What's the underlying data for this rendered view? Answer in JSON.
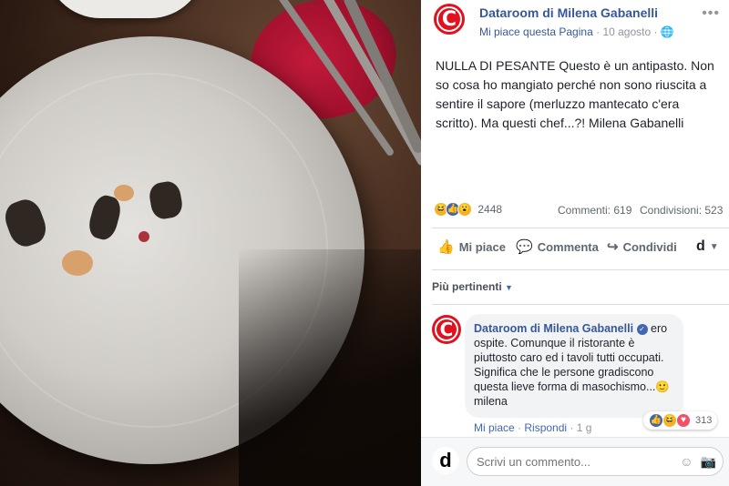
{
  "post": {
    "page_name": "Dataroom di Milena Gabanelli",
    "page_like": "Mi piace questa Pagina",
    "separator": "·",
    "date": "10 agosto",
    "text": "NULLA DI PESANTE Questo è un antipasto. Non so cosa ho mangiato perché non sono riuscita a sentire il sapore (merluzzo mantecato c'era scritto). Ma questi chef...?! Milena Gabanelli",
    "reactions_count": "2448",
    "comments_count": "Commenti: 619",
    "shares_count": "Condivisioni: 523",
    "actions": {
      "like": "Mi piace",
      "comment": "Commenta",
      "share": "Condividi"
    },
    "sort_label": "Più pertinenti",
    "avatar_letter": "C"
  },
  "comment": {
    "author": "Dataroom di Milena Gabanelli",
    "text": "ero ospite. Comunque il ristorante è piuttosto caro ed i tavoli tutti occupati. Significa che le persone gradiscono questa lieve forma di masochismo...🙂 milena",
    "like": "Mi piace",
    "reply": "Rispondi",
    "age": "1 g",
    "reactions_count": "313"
  },
  "composer": {
    "placeholder": "Scrivi un commento..."
  },
  "colors": {
    "link": "#365899",
    "brand_red": "#e0121f"
  }
}
